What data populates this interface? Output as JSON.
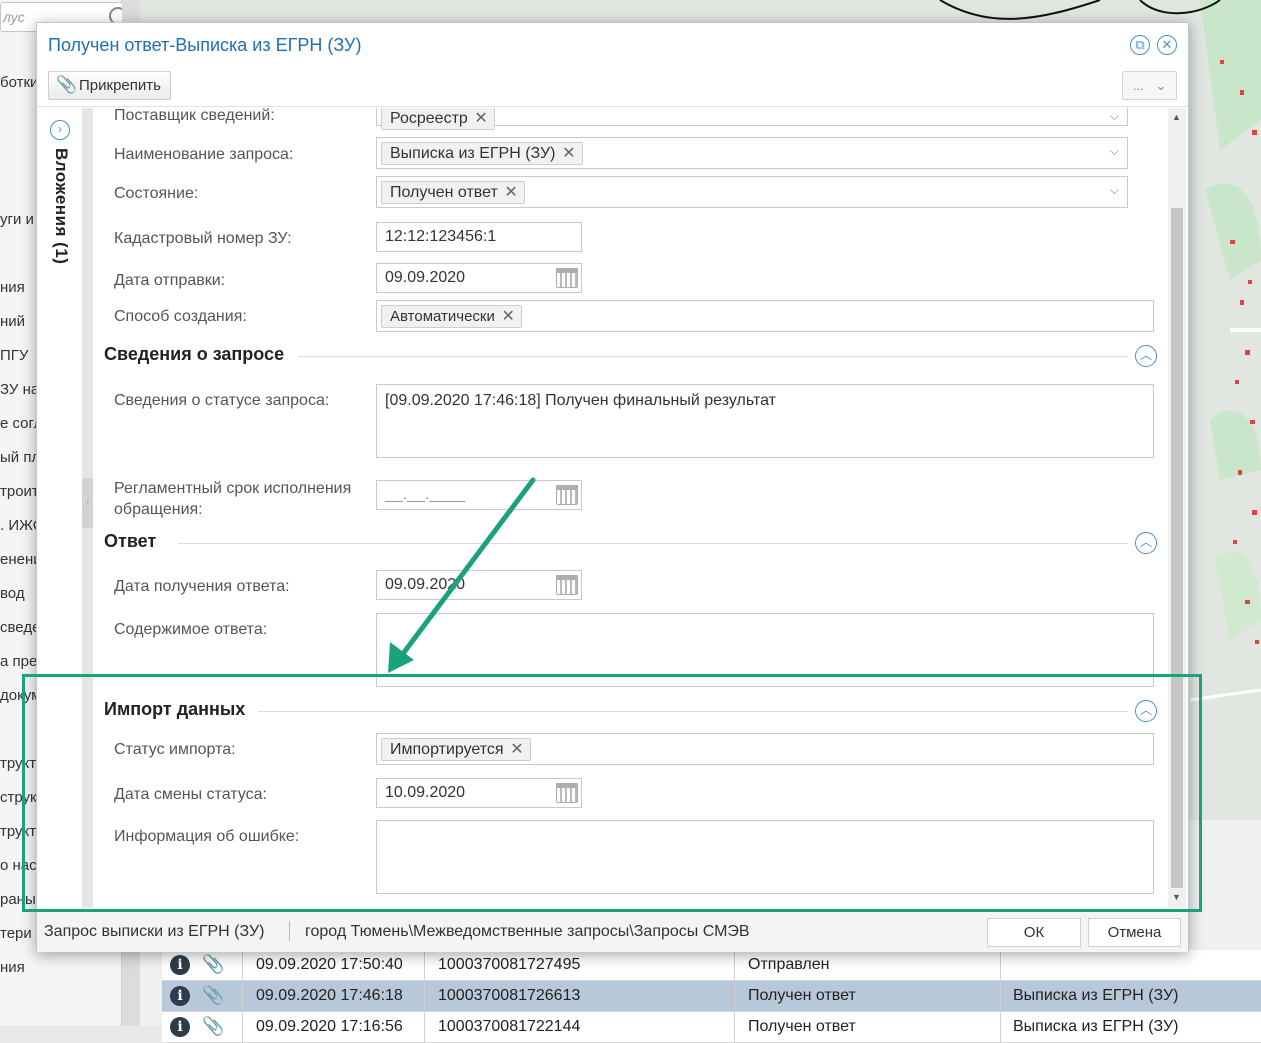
{
  "background": {
    "search_placeholder": "лус",
    "sidebar_items": [
      "ботки",
      "уги и",
      "ния",
      "ний",
      "ПГУ",
      "ЗУ на",
      "е согл",
      "ый пл",
      "троит",
      ". ИЖС",
      "енени",
      "вод",
      "сведе",
      "а пре",
      "докум",
      "трукт",
      "струк",
      "трукт",
      "о насл",
      "раны",
      "тери",
      "ния"
    ],
    "grid_rows": [
      {
        "datetime": "09.09.2020 17:50:40",
        "number": "1000370081727495",
        "status": "Отправлен",
        "type": "",
        "selected": false
      },
      {
        "datetime": "09.09.2020 17:46:18",
        "number": "1000370081726613",
        "status": "Получен ответ",
        "type": "Выписка из ЕГРН (ЗУ)",
        "selected": true
      },
      {
        "datetime": "09.09.2020 17:16:56",
        "number": "1000370081722144",
        "status": "Получен ответ",
        "type": "Выписка из ЕГРН (ЗУ)",
        "selected": false
      }
    ]
  },
  "dialog": {
    "title": "Получен ответ-Выписка из ЕГРН (ЗУ)",
    "toolbar": {
      "attach_label": "Прикрепить",
      "more_label": "..."
    },
    "side_panel_label": "Вложения (1)",
    "fields": {
      "supplier": {
        "label": "Поставщик сведений:",
        "value": "Росреестр"
      },
      "request_name": {
        "label": "Наименование запроса:",
        "value": "Выписка из ЕГРН (ЗУ)"
      },
      "state": {
        "label": "Состояние:",
        "value": "Получен ответ"
      },
      "cadastral": {
        "label": "Кадастровый номер ЗУ:",
        "value": "12:12:123456:1"
      },
      "send_date": {
        "label": "Дата отправки:",
        "value": "09.09.2020"
      },
      "creation_method": {
        "label": "Способ создания:",
        "value": "Автоматически"
      }
    },
    "sections": {
      "request_info": {
        "title": "Сведения о запросе",
        "status_label": "Сведения о статусе запроса:",
        "status_value": "[09.09.2020 17:46:18] Получен финальный результат",
        "deadline_label": "Регламентный срок исполнения обращения:",
        "deadline_value": "__.__.____"
      },
      "response": {
        "title": "Ответ",
        "date_label": "Дата получения ответа:",
        "date_value": "09.09.2020",
        "content_label": "Содержимое ответа:",
        "content_value": ""
      },
      "import": {
        "title": "Импорт данных",
        "status_label": "Статус импорта:",
        "status_value": "Импортируется",
        "change_date_label": "Дата смены статуса:",
        "change_date_value": "10.09.2020",
        "error_label": "Информация об ошибке:",
        "error_value": ""
      }
    },
    "footer": {
      "doc_type": "Запрос выписки из ЕГРН (ЗУ)",
      "path": "город Тюмень\\Межведомственные запросы\\Запросы СМЭВ",
      "ok_label": "ОК",
      "cancel_label": "Отмена"
    }
  },
  "colors": {
    "title_blue": "#1e6fb5",
    "annotation_green": "#1aa27f",
    "selected_row": "#b7c8d9"
  }
}
